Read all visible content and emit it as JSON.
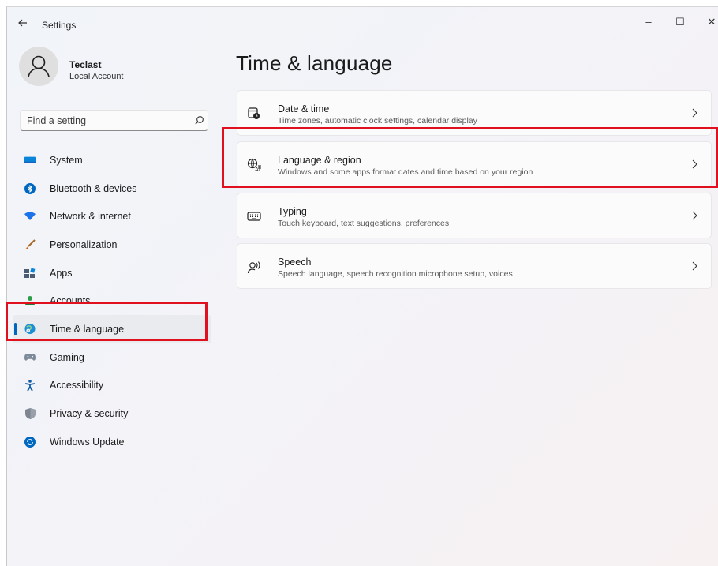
{
  "window": {
    "title": "Settings",
    "back_icon": "back-arrow-icon",
    "controls": {
      "minimize": "–",
      "maximize": "☐",
      "close": "✕"
    }
  },
  "profile": {
    "name": "Teclast",
    "subtitle": "Local Account"
  },
  "search": {
    "placeholder": "Find a setting"
  },
  "nav": {
    "items": [
      {
        "label": "System",
        "icon": "system-icon"
      },
      {
        "label": "Bluetooth & devices",
        "icon": "bluetooth-icon"
      },
      {
        "label": "Network & internet",
        "icon": "wifi-icon"
      },
      {
        "label": "Personalization",
        "icon": "brush-icon"
      },
      {
        "label": "Apps",
        "icon": "apps-icon"
      },
      {
        "label": "Accounts",
        "icon": "accounts-icon"
      },
      {
        "label": "Time & language",
        "icon": "time-language-icon",
        "selected": true
      },
      {
        "label": "Gaming",
        "icon": "gaming-icon"
      },
      {
        "label": "Accessibility",
        "icon": "accessibility-icon"
      },
      {
        "label": "Privacy & security",
        "icon": "shield-icon"
      },
      {
        "label": "Windows Update",
        "icon": "update-icon"
      }
    ]
  },
  "main": {
    "title": "Time & language",
    "cards": [
      {
        "title": "Date & time",
        "description": "Time zones, automatic clock settings, calendar display",
        "icon": "date-time-icon"
      },
      {
        "title": "Language & region",
        "description": "Windows and some apps format dates and time based on your region",
        "icon": "language-icon"
      },
      {
        "title": "Typing",
        "description": "Touch keyboard, text suggestions, preferences",
        "icon": "keyboard-icon"
      },
      {
        "title": "Speech",
        "description": "Speech language, speech recognition microphone setup, voices",
        "icon": "speech-icon"
      }
    ]
  },
  "colors": {
    "accent": "#0067c0",
    "highlight_box": "#e0101e",
    "selected_bg": "#eaebee"
  }
}
